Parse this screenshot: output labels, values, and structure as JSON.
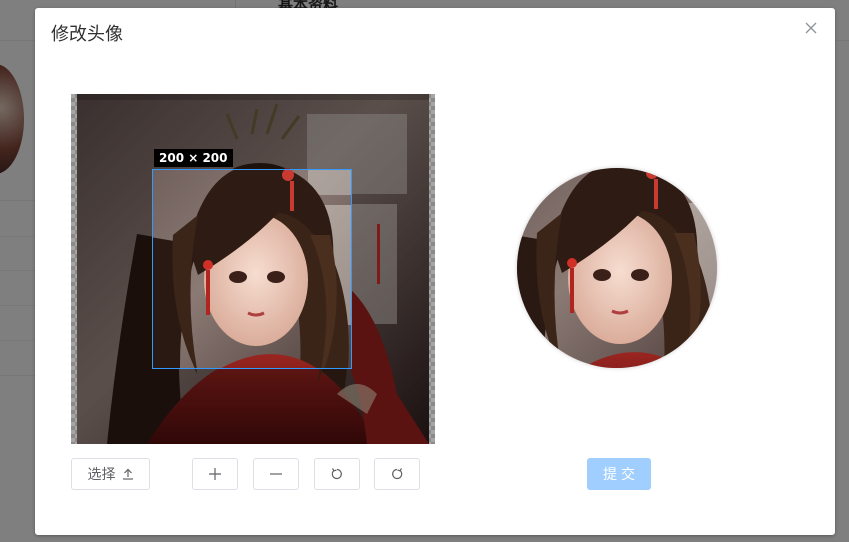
{
  "background": {
    "section_title": "基本资料"
  },
  "dialog": {
    "title": "修改头像",
    "close_icon": "close-icon"
  },
  "cropper": {
    "size_label": "200 × 200"
  },
  "toolbar": {
    "select_label": "选择",
    "select_icon": "upload-icon",
    "zoom_in_icon": "plus-icon",
    "zoom_out_icon": "minus-icon",
    "rotate_left_icon": "rotate-left-icon",
    "rotate_right_icon": "rotate-right-icon"
  },
  "submit": {
    "label": "提交"
  },
  "colors": {
    "primary_disabled": "#a0cfff",
    "crop_border": "#3399ff",
    "overlay": "rgba(0,0,0,0.5)"
  }
}
